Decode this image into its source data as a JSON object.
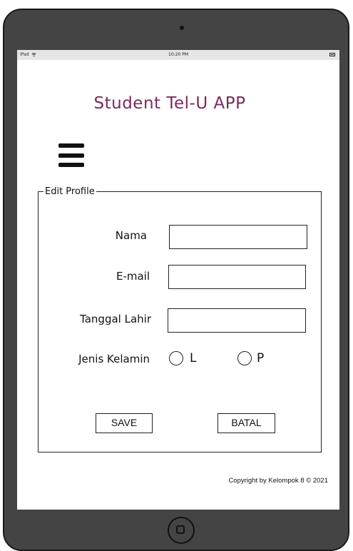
{
  "statusbar": {
    "device": "iPad",
    "time": "10:20 PM"
  },
  "app": {
    "title": "Student Tel-U APP"
  },
  "form": {
    "legend": "Edit Profile",
    "fields": {
      "nama_label": "Nama",
      "email_label": "E-mail",
      "tanggal_label": "Tanggal Lahir",
      "gender_label": "Jenis Kelamin",
      "gender_options": [
        "L",
        "P"
      ]
    },
    "buttons": {
      "save": "SAVE",
      "cancel": "BATAL"
    }
  },
  "footer": {
    "copyright": "Copyright by Kelompok 8 © 2021"
  },
  "colors": {
    "title": "#7a2a5a",
    "device_frame": "#444444",
    "statusbar": "#e6e6e6"
  },
  "icons": [
    "wifi-icon",
    "battery-icon",
    "hamburger-menu-icon",
    "home-button-icon"
  ]
}
